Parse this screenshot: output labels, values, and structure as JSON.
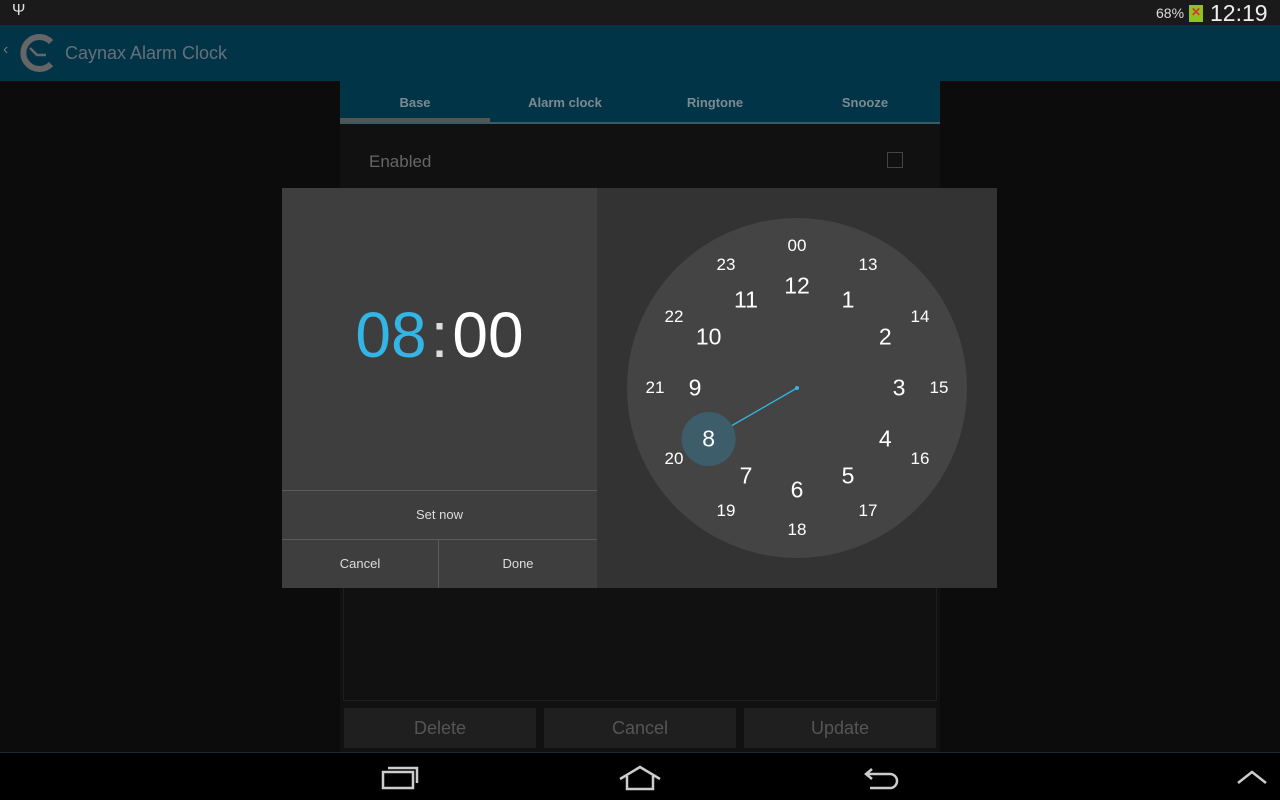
{
  "status_bar": {
    "usb_icon": "usb-icon",
    "battery": "68%",
    "battery_icon": "battery-charging-icon",
    "time": "12:19"
  },
  "action_bar": {
    "back_icon": "chevron-left-icon",
    "logo_icon": "alarm-clock-logo-icon",
    "title": "Caynax Alarm Clock"
  },
  "tabs": [
    {
      "label": "Base",
      "active": true
    },
    {
      "label": "Alarm clock"
    },
    {
      "label": "Ringtone"
    },
    {
      "label": "Snooze"
    }
  ],
  "settings": {
    "enabled_label": "Enabled",
    "enabled_checked": false
  },
  "bottom_buttons": {
    "delete": "Delete",
    "cancel": "Cancel",
    "update": "Update"
  },
  "dialog": {
    "hours": "08",
    "separator": ":",
    "minutes": "00",
    "set_now": "Set now",
    "cancel": "Cancel",
    "done": "Done",
    "selected_hour": 8,
    "accent": "#33b5e5",
    "inner_hours": [
      "12",
      "1",
      "2",
      "3",
      "4",
      "5",
      "6",
      "7",
      "8",
      "9",
      "10",
      "11"
    ],
    "outer_hours": [
      "00",
      "13",
      "14",
      "15",
      "16",
      "17",
      "18",
      "19",
      "20",
      "21",
      "22",
      "23"
    ]
  },
  "nav_bar": {
    "recent_icon": "recent-apps-icon",
    "home_icon": "home-icon",
    "back_icon": "back-icon",
    "up_icon": "chevron-up-icon"
  }
}
